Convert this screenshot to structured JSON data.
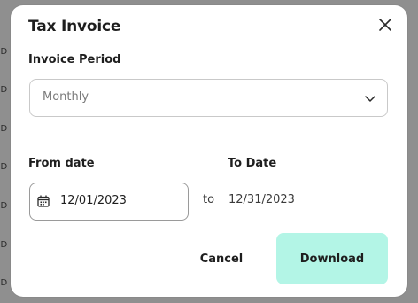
{
  "background": {
    "rows": [
      "SD",
      "SD",
      "SD",
      "SD",
      "SD",
      "SD",
      "SD",
      "SD"
    ]
  },
  "modal": {
    "title": "Tax Invoice",
    "close_icon": "close-icon",
    "invoice_period": {
      "label": "Invoice Period",
      "selected": "Monthly",
      "chevron_icon": "chevron-down-icon"
    },
    "from_date": {
      "label": "From date",
      "value": "12/01/2023",
      "calendar_icon": "calendar-icon"
    },
    "separator": "to",
    "to_date": {
      "label": "To Date",
      "value": "12/31/2023"
    },
    "actions": {
      "cancel_label": "Cancel",
      "download_label": "Download"
    }
  },
  "colors": {
    "overlay": "#8f8f8f",
    "download_bg": "#b3f5e6",
    "border": "#c9c9c9"
  }
}
